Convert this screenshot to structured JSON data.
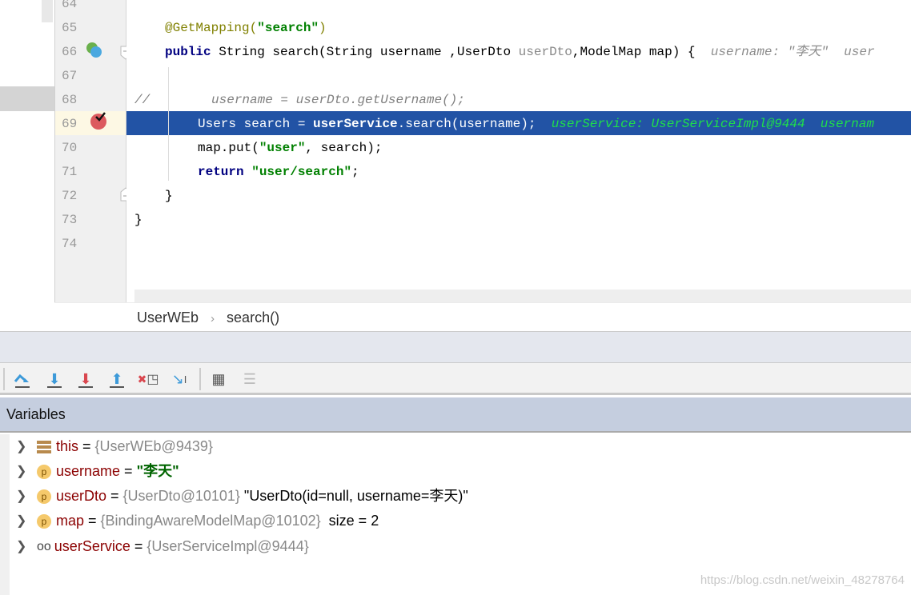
{
  "editor": {
    "line_numbers": [
      "64",
      "65",
      "66",
      "67",
      "68",
      "69",
      "70",
      "71",
      "72",
      "73",
      "74"
    ],
    "lines": {
      "l65": {
        "annotation": "@GetMapping",
        "open": "(",
        "str": "\"search\"",
        "close": ")"
      },
      "l66": {
        "kw": "public",
        "text1": " String search(String username ,UserDto ",
        "param_gray": "userDto",
        "text2": ",ModelMap map) {",
        "inline1": "username: \"李天\"",
        "inline2": "user"
      },
      "l68": {
        "comment": "//        username = userDto.getUsername();"
      },
      "l69": {
        "text1": "Users search = ",
        "bold": "userService",
        "text2": ".search(username);",
        "inline1": "userService: UserServiceImpl@9444",
        "inline2": "usernam"
      },
      "l70": {
        "text1": "map.put(",
        "str": "\"user\"",
        "text2": ", search);"
      },
      "l71": {
        "kw": "return",
        "str": "\"user/search\"",
        "text2": ";"
      },
      "l72": {
        "text": "}"
      },
      "l73": {
        "text": "}"
      }
    },
    "current_line": "69"
  },
  "breadcrumb": {
    "class": "UserWEb",
    "sep": "›",
    "method": "search()"
  },
  "toolbar": {
    "buttons": [
      "step-over-icon",
      "step-into-icon",
      "force-step-into-icon",
      "step-out-icon",
      "drop-frame-icon",
      "run-to-cursor-icon",
      "evaluate-expression-icon",
      "trace-stream-icon"
    ]
  },
  "variables": {
    "title": "Variables",
    "items": [
      {
        "name": "this",
        "eq": " = ",
        "ref": "{UserWEb@9439}",
        "extra": ""
      },
      {
        "name": "username",
        "eq": " = ",
        "ref": "",
        "str": "\"李天\"",
        "extra": ""
      },
      {
        "name": "userDto",
        "eq": " = ",
        "ref": "{UserDto@10101}",
        "extra": " \"UserDto(id=null, username=李天)\""
      },
      {
        "name": "map",
        "eq": " = ",
        "ref": "{BindingAwareModelMap@10102}",
        "extra": "  size = 2"
      },
      {
        "name": "userService",
        "eq": " = ",
        "ref": "{UserServiceImpl@9444}",
        "extra": ""
      }
    ]
  },
  "watermark": "https://blog.csdn.net/weixin_48278764"
}
